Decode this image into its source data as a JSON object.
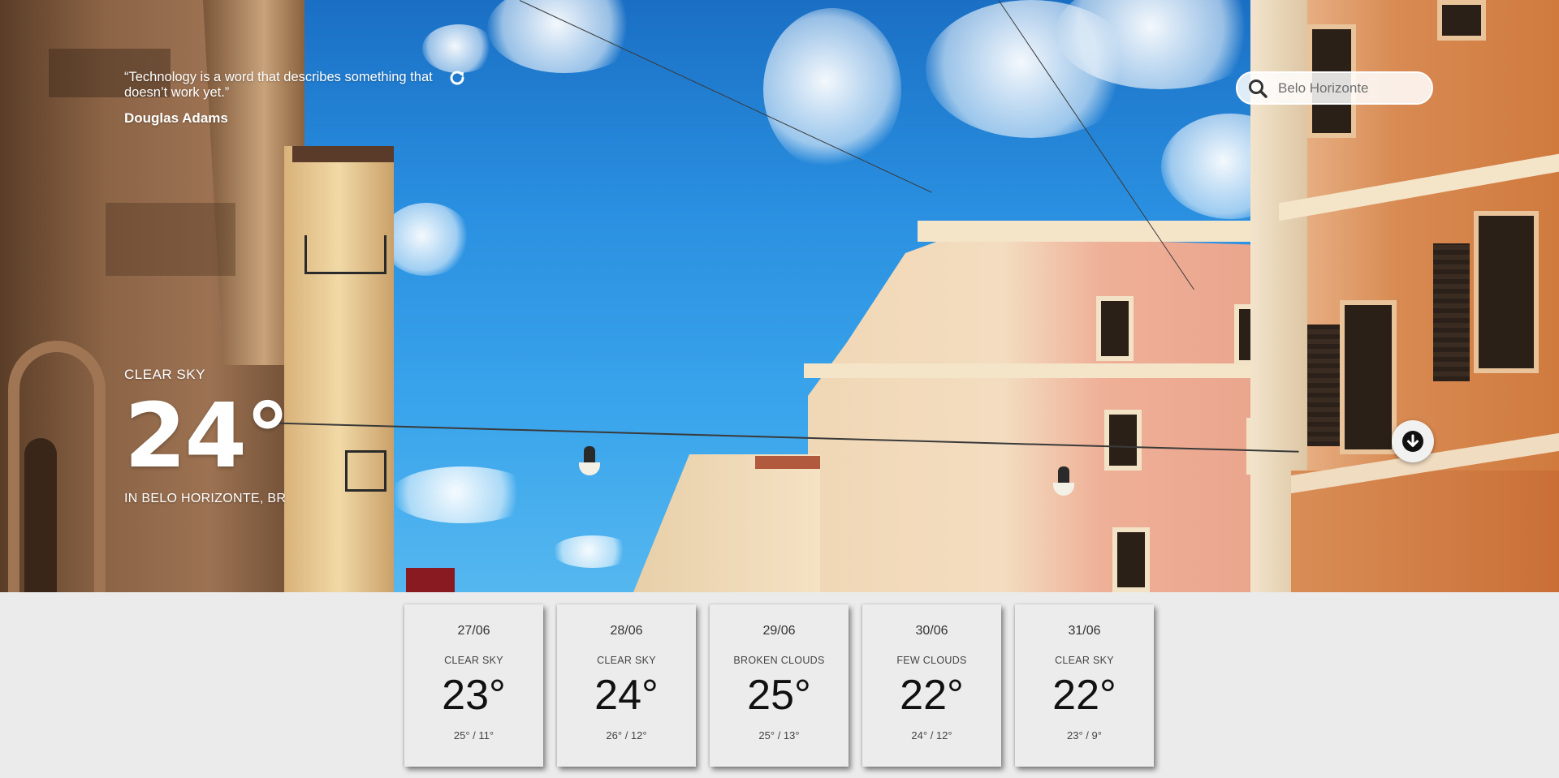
{
  "quote": {
    "text": "“Technology is a word that describes something that doesn’t work yet.”",
    "author": "Douglas Adams",
    "refresh_icon": "refresh-icon"
  },
  "search": {
    "placeholder": "Belo Horizonte",
    "icon": "search-icon"
  },
  "current": {
    "description": "CLEAR SKY",
    "temperature": "24°",
    "location": "IN BELO HORIZONTE, BR"
  },
  "scroll_down_icon": "arrow-down-circle-icon",
  "forecast": [
    {
      "date": "27/06",
      "description": "CLEAR SKY",
      "temperature": "23°",
      "range": "25° / 11°"
    },
    {
      "date": "28/06",
      "description": "CLEAR SKY",
      "temperature": "24°",
      "range": "26° / 12°"
    },
    {
      "date": "29/06",
      "description": "BROKEN CLOUDS",
      "temperature": "25°",
      "range": "25° / 13°"
    },
    {
      "date": "30/06",
      "description": "FEW CLOUDS",
      "temperature": "22°",
      "range": "24° / 12°"
    },
    {
      "date": "31/06",
      "description": "CLEAR SKY",
      "temperature": "22°",
      "range": "23° / 9°"
    }
  ],
  "colors": {
    "sky": "#2a8fe0",
    "forecast_background": "#ebebeb",
    "card_background": "#ececec",
    "text_light": "#ffffff"
  }
}
